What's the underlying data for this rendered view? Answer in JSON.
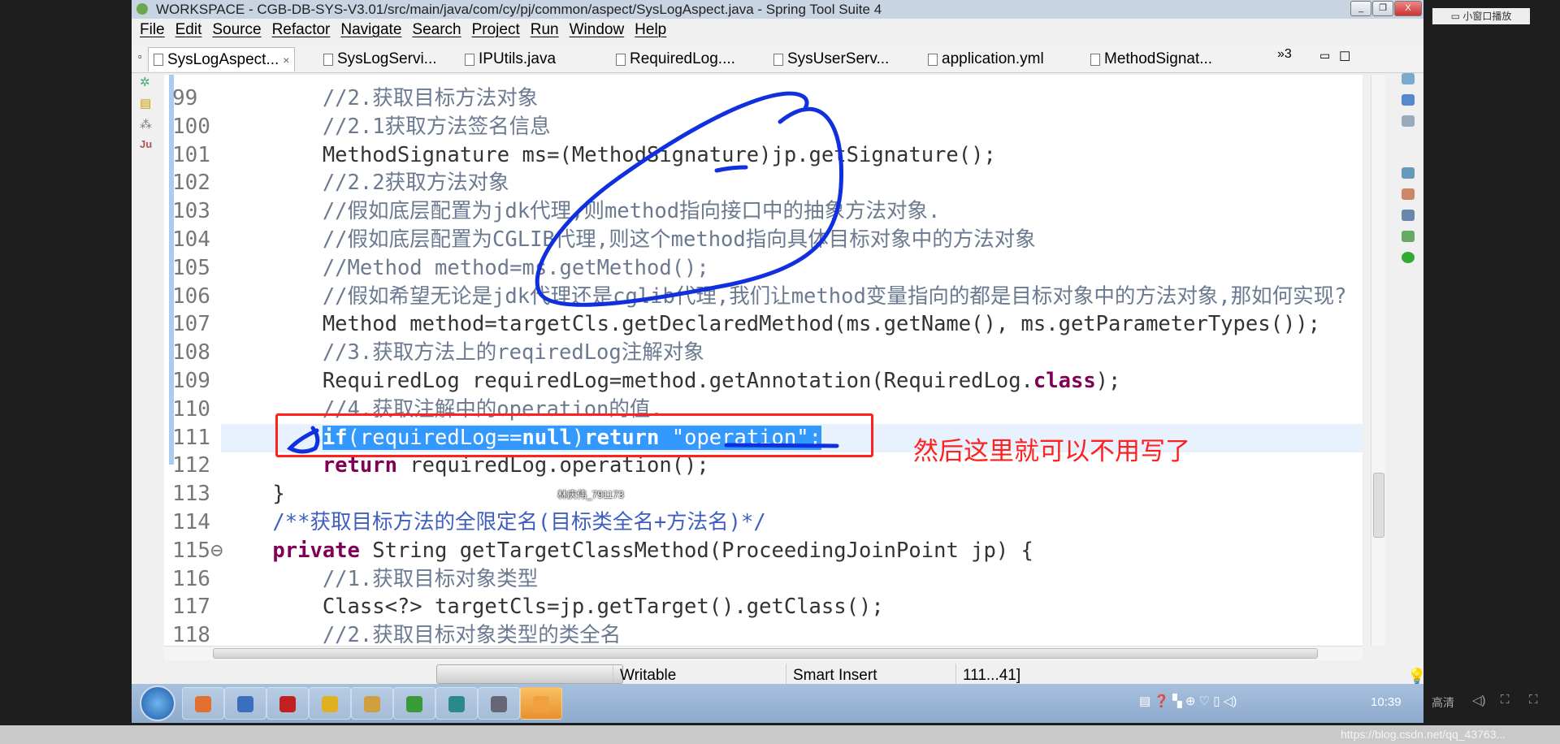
{
  "window": {
    "title": "WORKSPACE - CGB-DB-SYS-V3.01/src/main/java/com/cy/pj/common/aspect/SysLogAspect.java - Spring Tool Suite 4"
  },
  "menu": [
    "File",
    "Edit",
    "Source",
    "Refactor",
    "Navigate",
    "Search",
    "Project",
    "Run",
    "Window",
    "Help"
  ],
  "tabs": [
    {
      "label": "SysLogAspect...",
      "active": true,
      "close": "×"
    },
    {
      "label": "SysLogServi..."
    },
    {
      "label": "IPUtils.java"
    },
    {
      "label": "RequiredLog...."
    },
    {
      "label": "SysUserServ..."
    },
    {
      "label": "application.yml"
    },
    {
      "label": "MethodSignat..."
    }
  ],
  "tab_overflow": "»3",
  "code": [
    {
      "n": "99",
      "t": [
        [
          "        ",
          ""
        ],
        [
          "//2.获取目标方法对象",
          "c"
        ]
      ]
    },
    {
      "n": "100",
      "t": [
        [
          "        ",
          ""
        ],
        [
          "//2.1获取方法签名信息",
          "c"
        ]
      ]
    },
    {
      "n": "101",
      "t": [
        [
          "        MethodSignature ms=(MethodSignature)jp.getSignature();",
          ""
        ]
      ]
    },
    {
      "n": "102",
      "t": [
        [
          "        ",
          ""
        ],
        [
          "//2.2获取方法对象",
          "c"
        ]
      ]
    },
    {
      "n": "103",
      "t": [
        [
          "        ",
          ""
        ],
        [
          "//假如底层配置为jdk代理,则method指向接口中的抽象方法对象.",
          "c"
        ]
      ]
    },
    {
      "n": "104",
      "t": [
        [
          "        ",
          ""
        ],
        [
          "//假如底层配置为CGLIB代理,则这个method指向具体目标对象中的方法对象",
          "c"
        ]
      ]
    },
    {
      "n": "105",
      "t": [
        [
          "        ",
          ""
        ],
        [
          "//Method method=ms.getMethod();",
          "c"
        ]
      ]
    },
    {
      "n": "106",
      "t": [
        [
          "        ",
          ""
        ],
        [
          "//假如希望无论是jdk代理还是cglib代理,我们让method变量指向的都是目标对象中的方法对象,那如何实现?",
          "c"
        ]
      ]
    },
    {
      "n": "107",
      "t": [
        [
          "        Method method=targetCls.getDeclaredMethod(ms.getName(), ms.getParameterTypes());",
          ""
        ]
      ]
    },
    {
      "n": "108",
      "t": [
        [
          "        ",
          ""
        ],
        [
          "//3.获取方法上的reqiredLog注解对象",
          "c"
        ]
      ]
    },
    {
      "n": "109",
      "t": [
        [
          "        RequiredLog requiredLog=method.getAnnotation(RequiredLog.",
          ""
        ],
        [
          "class",
          "k"
        ],
        [
          ");",
          ""
        ]
      ]
    },
    {
      "n": "110",
      "t": [
        [
          "        ",
          ""
        ],
        [
          "//4.获取注解中的operation的值.",
          "c"
        ]
      ]
    },
    {
      "n": "111",
      "t": [
        [
          "        ",
          ""
        ],
        [
          "if",
          "k sel"
        ],
        [
          "(requiredLog==",
          "sel"
        ],
        [
          "null",
          "k sel"
        ],
        [
          ")",
          "sel"
        ],
        [
          "return",
          "k sel"
        ],
        [
          " \"operation\";",
          "sel"
        ]
      ],
      "current": true
    },
    {
      "n": "112",
      "t": [
        [
          "        ",
          ""
        ],
        [
          "return",
          "k"
        ],
        [
          " requiredLog.operation();",
          ""
        ]
      ]
    },
    {
      "n": "113",
      "t": [
        [
          "    }",
          ""
        ]
      ]
    },
    {
      "n": "114",
      "t": [
        [
          "    ",
          ""
        ],
        [
          "/**获取目标方法的全限定名(目标类全名+方法名)*/",
          "j"
        ]
      ]
    },
    {
      "n": "115⊖",
      "t": [
        [
          "    ",
          ""
        ],
        [
          "private",
          "k"
        ],
        [
          " String getTargetClassMethod(ProceedingJoinPoint jp) {",
          ""
        ]
      ]
    },
    {
      "n": "116",
      "t": [
        [
          "        ",
          ""
        ],
        [
          "//1.获取目标对象类型",
          "c"
        ]
      ]
    },
    {
      "n": "117",
      "t": [
        [
          "        Class<?> targetCls=jp.getTarget().getClass();",
          ""
        ]
      ]
    },
    {
      "n": "118",
      "t": [
        [
          "        ",
          ""
        ],
        [
          "//2.获取目标对象类型的类全名",
          "c"
        ]
      ]
    }
  ],
  "status": {
    "mode": "Writable",
    "insert": "Smart Insert",
    "position": "111...41]"
  },
  "taskbar": {
    "clock": "10:39",
    "icons": [
      "start-orb",
      "360-icon",
      "p-icon",
      "filezilla-icon",
      "chrome-icon",
      "folder-icon",
      "sts-icon",
      "editor-icon",
      "cmd-icon",
      "video-icon"
    ]
  },
  "player": {
    "mini_window": "▭ 小窗口播放",
    "quality": "高清"
  },
  "annotation": {
    "note": "然后这里就可以不用写了",
    "color": "#ff2020",
    "ink": "#1030e0"
  },
  "watermarks": {
    "author": "林庆伟_791173",
    "url": "https://blog.csdn.net/qq_43763..."
  }
}
